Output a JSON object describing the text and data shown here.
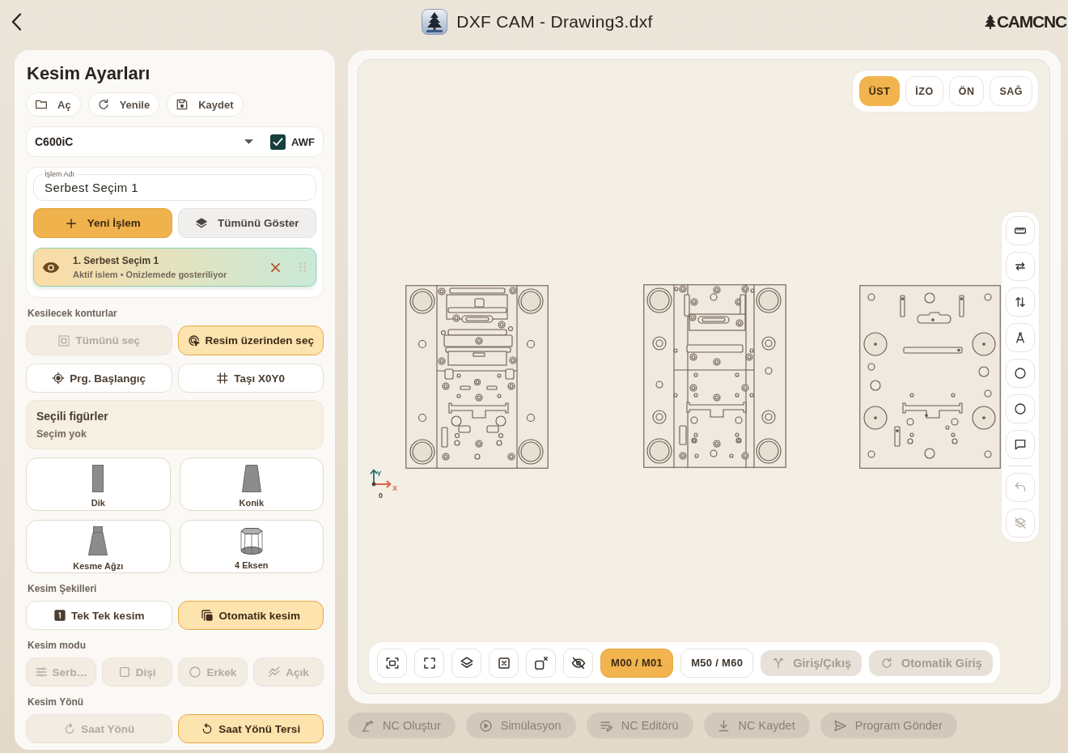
{
  "header": {
    "title": "DXF CAM - Drawing3.dxf",
    "logo": "CAMCNC"
  },
  "settings": {
    "title": "Kesim Ayarları",
    "file_buttons": [
      {
        "label": "Aç",
        "kind": "open"
      },
      {
        "label": "Yenile",
        "kind": "refresh"
      },
      {
        "label": "Kaydet",
        "kind": "save"
      }
    ],
    "machine": {
      "value": "C600iC",
      "awf": {
        "label": "AWF",
        "checked": true
      }
    },
    "operation": {
      "name_field": {
        "label": "İşlem Adı",
        "value": "Serbest Seçim 1"
      },
      "buttons": [
        {
          "label": "Yeni İşlem",
          "kind": "add",
          "primary": true
        },
        {
          "label": "Tümünü Göster",
          "kind": "layers",
          "primary": false
        }
      ],
      "items": [
        {
          "title": "1. Serbest Seçim 1",
          "subtitle": "Aktif islem • Onizlemede gosteriliyor",
          "selected": true
        }
      ]
    },
    "contours": {
      "label": "Kesilecek konturlar",
      "options": [
        {
          "label": "Tümünü seç",
          "kind": "select-all",
          "disabled": true,
          "selected": false
        },
        {
          "label": "Resim üzerinden seç",
          "kind": "pick",
          "disabled": false,
          "selected": true
        }
      ],
      "actions": [
        {
          "label": "Prg. Başlangıç",
          "kind": "origin"
        },
        {
          "label": "Taşı X0Y0",
          "kind": "grid"
        }
      ]
    },
    "selected_figures": {
      "title": "Seçili figürler",
      "value": "Seçim yok"
    },
    "cut_types": [
      {
        "label": "Dik",
        "kind": "straight",
        "selected": false
      },
      {
        "label": "Konik",
        "kind": "taper",
        "selected": false
      },
      {
        "label": "Kesme Ağzı",
        "kind": "nozzle",
        "selected": false
      },
      {
        "label": "4 Eksen",
        "kind": "four-axis",
        "selected": false
      }
    ],
    "cut_shapes": {
      "label": "Kesim Şekilleri",
      "options": [
        {
          "label": "Tek Tek kesim",
          "kind": "single",
          "disabled": false,
          "selected": false
        },
        {
          "label": "Otomatik kesim",
          "kind": "auto",
          "disabled": false,
          "selected": true
        }
      ]
    },
    "cut_mode": {
      "label": "Kesim modu",
      "options": [
        {
          "label": "Serb…",
          "kind": "free",
          "disabled": true,
          "selected": false
        },
        {
          "label": "Dişi",
          "kind": "female",
          "disabled": true,
          "selected": false
        },
        {
          "label": "Erkek",
          "kind": "male",
          "disabled": true,
          "selected": false
        },
        {
          "label": "Açık",
          "kind": "open-path",
          "disabled": true,
          "selected": false
        }
      ]
    },
    "cut_direction": {
      "label": "Kesim Yönü",
      "options": [
        {
          "label": "Saat Yönü",
          "kind": "cw",
          "disabled": true,
          "selected": false
        },
        {
          "label": "Saat Yönü Tersi",
          "kind": "ccw",
          "disabled": false,
          "selected": true
        }
      ]
    }
  },
  "canvas": {
    "views": [
      {
        "label": "ÜST",
        "selected": true
      },
      {
        "label": "İZO",
        "selected": false
      },
      {
        "label": "ÖN",
        "selected": false
      },
      {
        "label": "SAĞ",
        "selected": false
      }
    ],
    "side_tools": [
      {
        "kind": "ruler",
        "disabled": false
      },
      {
        "kind": "swap-horizontal",
        "disabled": false
      },
      {
        "kind": "swap-vertical",
        "disabled": false
      },
      {
        "kind": "compass",
        "disabled": false
      },
      {
        "kind": "circle",
        "disabled": false
      },
      {
        "kind": "circle",
        "disabled": false
      },
      {
        "kind": "comment",
        "disabled": false
      }
    ],
    "history_tools": [
      {
        "kind": "undo",
        "disabled": true
      },
      {
        "kind": "layers-off",
        "disabled": true
      }
    ],
    "axis": {
      "x": "X",
      "y": "Y",
      "origin": "0"
    },
    "view_tools": [
      {
        "kind": "fit"
      },
      {
        "kind": "fullscreen"
      },
      {
        "kind": "layers-outline"
      },
      {
        "kind": "box-x"
      },
      {
        "kind": "shape-x"
      },
      {
        "kind": "eye-off"
      }
    ],
    "m_codes": [
      {
        "label": "M00 / M01",
        "selected": true
      },
      {
        "label": "M50 / M60",
        "selected": false
      }
    ],
    "lead_tools": [
      {
        "label": "Giriş/Çıkış",
        "kind": "fork",
        "disabled": true
      },
      {
        "label": "Otomatik Giriş",
        "kind": "refresh",
        "disabled": true
      }
    ]
  },
  "actions": [
    {
      "label": "NC Oluştur",
      "kind": "robot",
      "disabled": true
    },
    {
      "label": "Simülasyon",
      "kind": "play",
      "disabled": true
    },
    {
      "label": "NC Editörü",
      "kind": "edit",
      "disabled": true
    },
    {
      "label": "NC Kaydet",
      "kind": "download",
      "disabled": true
    },
    {
      "label": "Program Gönder",
      "kind": "send",
      "disabled": true
    }
  ]
}
